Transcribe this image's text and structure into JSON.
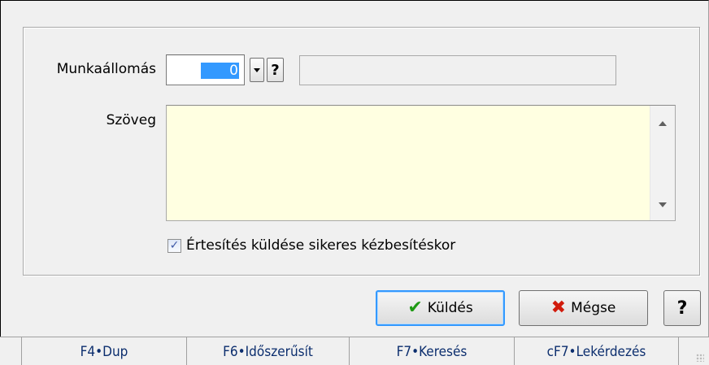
{
  "form": {
    "workstation_label": "Munkaállomás",
    "workstation_value": "0",
    "dropdown_icon": "chevron-down-icon",
    "lookup_label": "?",
    "workstation_name": "",
    "text_label": "Szöveg",
    "text_value": "",
    "memo_bg": "#ffffe1",
    "notify_label": "Értesítés küldése sikeres kézbesítéskor",
    "notify_checked": true
  },
  "buttons": {
    "send_label": "Küldés",
    "cancel_label": "Mégse",
    "help_label": "?",
    "send_icon": "checkmark-icon",
    "cancel_icon": "x-icon",
    "accent": "#3399ff"
  },
  "function_keys": [
    {
      "label": "F4•Dup"
    },
    {
      "label": "F6•Időszerűsít"
    },
    {
      "label": "F7•Keresés"
    },
    {
      "label": "cF7•Lekérdezés"
    }
  ]
}
